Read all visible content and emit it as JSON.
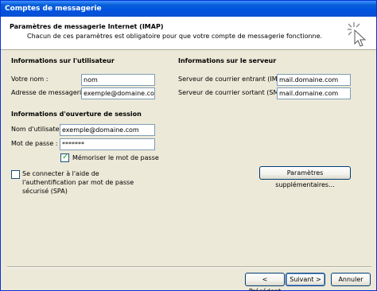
{
  "window": {
    "title": "Comptes de messagerie"
  },
  "header": {
    "title": "Paramètres de messagerie Internet (IMAP)",
    "description": "Chacun de ces paramètres est obligatoire pour que votre compte de messagerie fonctionne."
  },
  "user_info": {
    "title": "Informations sur l'utilisateur",
    "name_label": "Votre nom :",
    "name_value": "nom",
    "email_label": "Adresse de messagerie :",
    "email_value": "exemple@domaine.com"
  },
  "server_info": {
    "title": "Informations sur le serveur",
    "incoming_label": "Serveur de courrier entrant (IMAP) :",
    "incoming_value": "mail.domaine.com",
    "outgoing_label": "Serveur de courrier sortant (SMTP) :",
    "outgoing_value": "mail.domaine.com"
  },
  "logon_info": {
    "title": "Informations d'ouverture de session",
    "username_label": "Nom d'utilisateur :",
    "username_value": "exemple@domaine.com",
    "password_label": "Mot de passe :",
    "password_value": "*******",
    "remember_label": "Mémoriser le mot de passe",
    "remember_checked": true
  },
  "spa": {
    "label_line1": "Se connecter à l'aide de",
    "label_line2": "l'authentification par mot de passe",
    "label_line3": "sécurisé (SPA)",
    "checked": false
  },
  "more_settings_button": "Paramètres supplémentaires...",
  "footer": {
    "back_button": "< Précédent",
    "next_button": "Suivant >",
    "cancel_button": "Annuler"
  }
}
